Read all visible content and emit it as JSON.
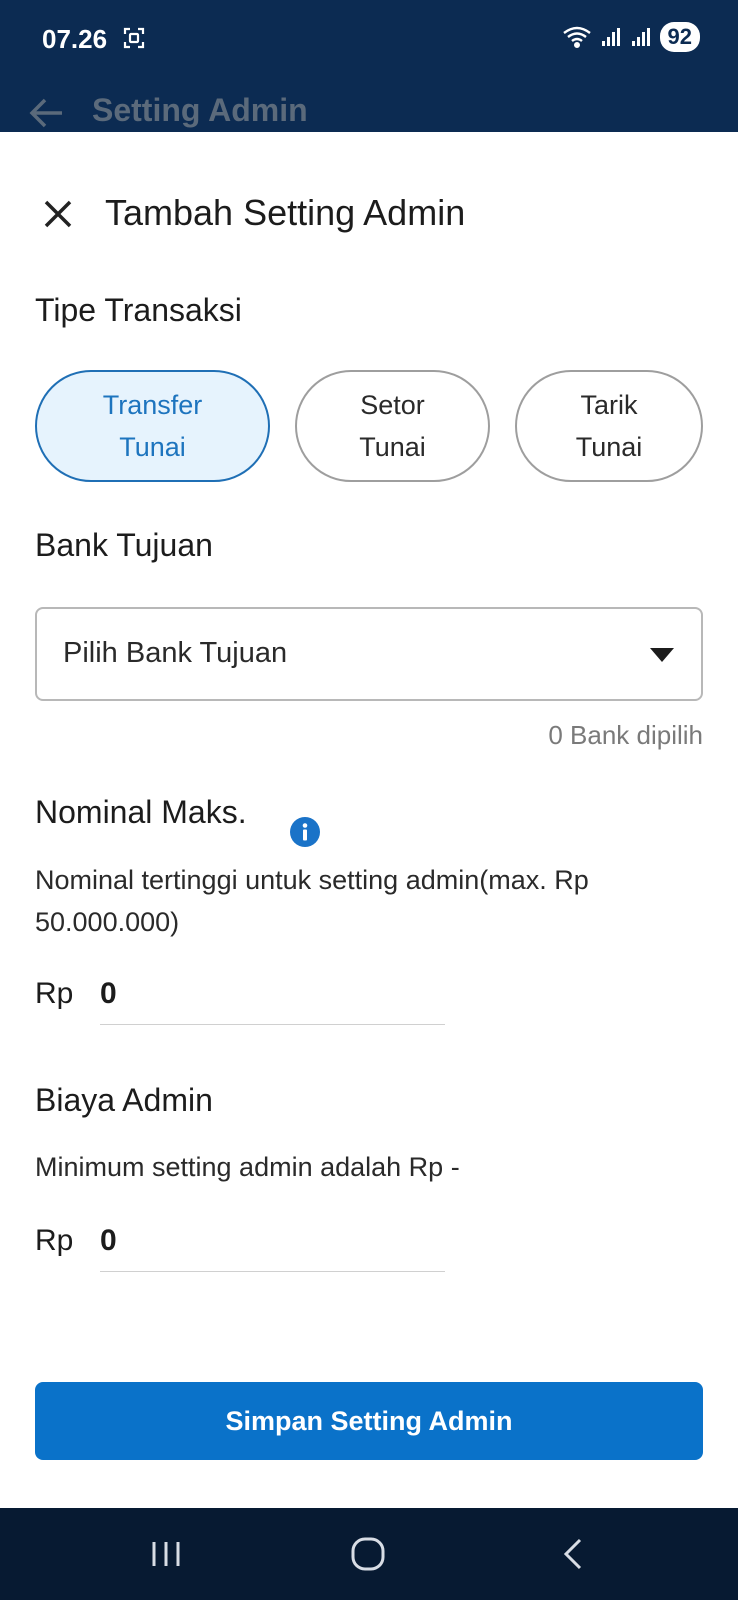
{
  "status_bar": {
    "time": "07.26",
    "battery": "92"
  },
  "app_bar": {
    "title": "Setting Admin"
  },
  "sheet": {
    "title": "Tambah Setting Admin",
    "transaction_type": {
      "label": "Tipe Transaksi",
      "options": [
        {
          "line1": "Transfer",
          "line2": "Tunai",
          "selected": true
        },
        {
          "line1": "Setor",
          "line2": "Tunai",
          "selected": false
        },
        {
          "line1": "Tarik",
          "line2": "Tunai",
          "selected": false
        }
      ]
    },
    "destination_bank": {
      "label": "Bank Tujuan",
      "placeholder": "Pilih Bank Tujuan",
      "selected_count": "0 Bank dipilih"
    },
    "max_nominal": {
      "label": "Nominal Maks.",
      "helper": "Nominal tertinggi untuk setting admin(max. Rp 50.000.000)",
      "currency": "Rp",
      "value": "0"
    },
    "admin_fee": {
      "label": "Biaya Admin",
      "helper": "Minimum setting admin adalah Rp -",
      "currency": "Rp",
      "value": "0"
    },
    "save_label": "Simpan Setting Admin"
  },
  "colors": {
    "primary": "#0a72c9",
    "header": "#0c2b52",
    "chip_selected_bg": "#e6f3fd"
  },
  "icons": [
    "screenshot-icon",
    "wifi-icon",
    "signal-icon",
    "back-arrow-icon",
    "close-icon",
    "caret-down-icon",
    "info-icon",
    "recents-icon",
    "home-icon",
    "back-icon"
  ]
}
